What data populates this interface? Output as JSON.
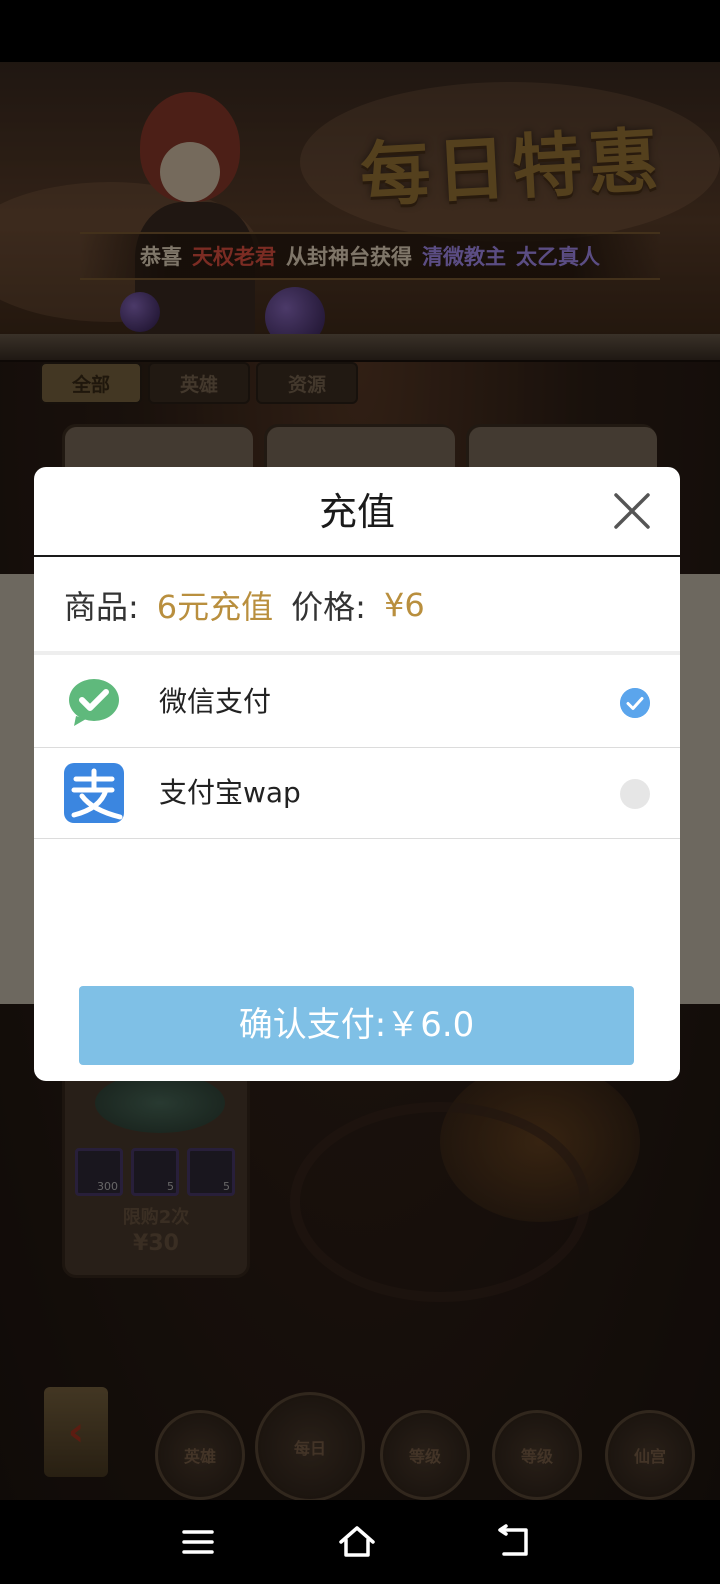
{
  "game": {
    "banner_title": "每日特惠",
    "ticker": {
      "prefix": "恭喜",
      "player": "天权老君",
      "middle": "从封神台获得",
      "reward_1": "清微教主",
      "reward_2": "太乙真人"
    },
    "tabs": [
      {
        "label": "全部",
        "active": true
      },
      {
        "label": "英雄",
        "active": false
      },
      {
        "label": "资源",
        "active": false
      }
    ],
    "bottom_card": {
      "items": [
        {
          "icon": "coin-icon",
          "count": "300"
        },
        {
          "icon": "scroll-icon",
          "count": "5"
        },
        {
          "icon": "card-icon",
          "count": "5"
        }
      ],
      "limit": "限购2次",
      "price": "¥30"
    },
    "nav_fans": [
      "英雄",
      "每日",
      "等级",
      "等级",
      "仙宫"
    ]
  },
  "dialog": {
    "title": "充值",
    "product_label": "商品:",
    "product_value": "6元充值",
    "price_label": "价格:",
    "price_value": "¥6",
    "payment_methods": [
      {
        "label": "微信支付",
        "icon": "wechat-pay-icon",
        "selected": true
      },
      {
        "label": "支付宝wap",
        "icon": "alipay-icon",
        "selected": false
      }
    ],
    "confirm_label": "确认支付:￥6.0"
  },
  "colors": {
    "accent_gold": "#b98f3e",
    "confirm_bg": "#7fc0e6",
    "radio_selected": "#5ba5ec",
    "wechat_green": "#5fb97c",
    "alipay_blue": "#3b86e0"
  }
}
